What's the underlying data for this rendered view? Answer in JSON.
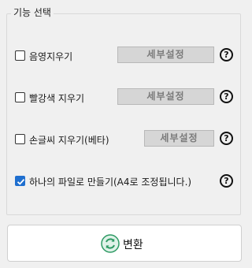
{
  "group": {
    "title": "기능 선택"
  },
  "options": [
    {
      "label": "음영지우기",
      "checked": false,
      "settings_label": "세부설정"
    },
    {
      "label": "빨강색 지우기",
      "checked": false,
      "settings_label": "세부설정"
    },
    {
      "label": "손글씨 지우기(베타)",
      "checked": false,
      "settings_label": "세부설정"
    },
    {
      "label": "하나의 파일로 만들기(A4로 조정됩니다.)",
      "checked": true
    }
  ],
  "help_label": "?",
  "convert": {
    "label": "변환",
    "icon": "refresh-icon",
    "icon_color": "#2e9a64"
  },
  "colors": {
    "checked": "#1f6fcf",
    "settings_button": "#d6d6d6"
  }
}
